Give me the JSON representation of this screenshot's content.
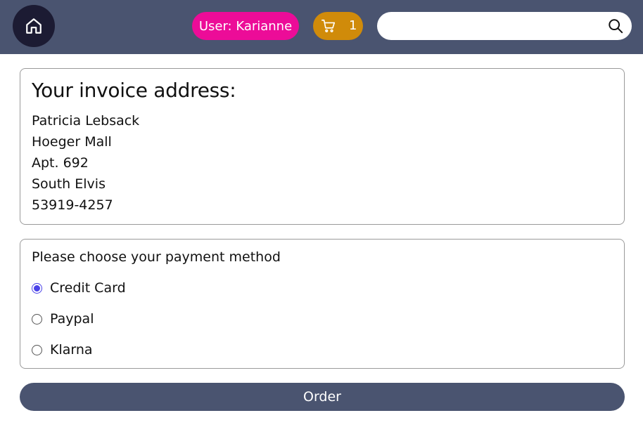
{
  "header": {
    "home_icon": "home-icon",
    "user_label": "User: Karianne",
    "cart_icon": "cart-icon",
    "cart_count": "1",
    "search": {
      "value": "",
      "placeholder": "",
      "icon": "search-icon"
    },
    "colors": {
      "bar": "#4a5470",
      "home": "#1c1b33",
      "user": "#ec0c98",
      "cart": "#d08b0a"
    }
  },
  "invoice": {
    "title": "Your invoice address:",
    "lines": [
      "Patricia Lebsack",
      "Hoeger Mall",
      "Apt. 692",
      "South Elvis",
      "53919-4257"
    ]
  },
  "payment": {
    "title": "Please choose your payment method",
    "options": [
      {
        "label": "Credit Card",
        "selected": true
      },
      {
        "label": "Paypal",
        "selected": false
      },
      {
        "label": "Klarna",
        "selected": false
      }
    ],
    "accent": "#4a42e8"
  },
  "order": {
    "label": "Order"
  }
}
